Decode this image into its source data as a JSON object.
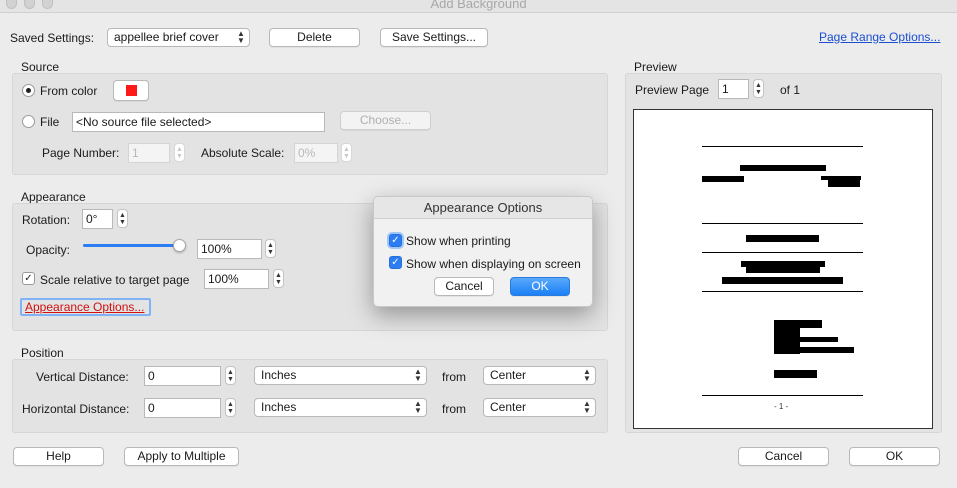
{
  "window": {
    "title": "Add Background"
  },
  "header": {
    "saved_settings_label": "Saved Settings:",
    "saved_settings_value": "appellee brief cover",
    "delete_label": "Delete",
    "save_settings_label": "Save Settings...",
    "page_range_options_label": "Page Range Options..."
  },
  "source": {
    "section_label": "Source",
    "from_color_label": "From color",
    "from_color_swatch": "#ff1a1a",
    "file_label": "File",
    "file_value": "<No source file selected>",
    "choose_label": "Choose...",
    "page_number_label": "Page Number:",
    "page_number_value": "1",
    "absolute_scale_label": "Absolute Scale:",
    "absolute_scale_value": "0%"
  },
  "appearance": {
    "section_label": "Appearance",
    "rotation_label": "Rotation:",
    "rotation_value": "0°",
    "opacity_label": "Opacity:",
    "opacity_value": "100%",
    "opacity_level": 1.0,
    "scale_label": "Scale relative to target page",
    "scale_value": "100%",
    "appearance_options_label": "Appearance Options..."
  },
  "position": {
    "section_label": "Position",
    "vertical_label": "Vertical Distance:",
    "vertical_value": "0",
    "vertical_unit": "Inches",
    "vertical_from_label": "from",
    "vertical_from_value": "Center",
    "horizontal_label": "Horizontal Distance:",
    "horizontal_value": "0",
    "horizontal_unit": "Inches",
    "horizontal_from_label": "from",
    "horizontal_from_value": "Center"
  },
  "preview": {
    "section_label": "Preview",
    "preview_page_label": "Preview Page",
    "page_value": "1",
    "of_label": "of 1",
    "page_footer": "- 1 -"
  },
  "footer": {
    "help_label": "Help",
    "apply_multiple_label": "Apply to Multiple",
    "cancel_label": "Cancel",
    "ok_label": "OK"
  },
  "dialog": {
    "title": "Appearance Options",
    "show_printing_label": "Show when printing",
    "show_screen_label": "Show when displaying on screen",
    "cancel_label": "Cancel",
    "ok_label": "OK"
  },
  "colors": {
    "accent": "#2c7df4",
    "link": "#1a4fd0",
    "swatch": "#ff1a1a"
  },
  "icons": [
    "chevron-updown-icon",
    "stepper-icon",
    "checkmark-icon",
    "radio-icon"
  ]
}
